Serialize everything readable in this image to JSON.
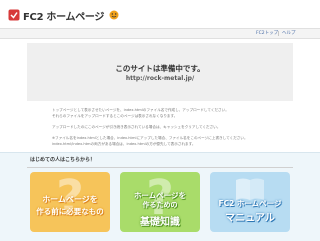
{
  "header": {
    "logo_text": "FC2 ホームページ",
    "logo_icon": "fc2-logo-icon",
    "smile_icon": "smile-icon"
  },
  "nav": {
    "items": [
      {
        "label": "FC2トップ"
      },
      {
        "label": "ヘルプ"
      }
    ]
  },
  "notice": {
    "title": "このサイトは準備中です。",
    "url": "http://rock-metal.jp/"
  },
  "description": {
    "lines": [
      "トップページとして表示させたいページを、index.htmlのファイル名で作成し、アップロードしてください。",
      "それらのファイルをアップロードするとこのページは表示されなくなります。",
      "アップロードしたのにこのページが引き続き表示されている場合は、キャッシュをクリアしてください。",
      "※ファイル名をindex.htmlとした場合、index.htmlにアップした場合、ファイル名をこのページに上書きしてください。",
      "index.html/index.htmの両方がある場合は、index.htmlの方が優先して表示されます。"
    ]
  },
  "section": {
    "title": "はじめての人はこちらから！"
  },
  "cards": [
    {
      "line1": "ホームページを",
      "line2": "作る前に必要なもの",
      "mark": "?"
    },
    {
      "line1": "ホームページを",
      "line2": "作るための",
      "line3": "基礎知識",
      "mark": "?"
    },
    {
      "line1": "FC2 ホームページ",
      "line2": "マニュアル",
      "mark": "?"
    }
  ],
  "colors": {
    "card1": "#f6c45a",
    "card2": "#a9dc6a",
    "card3": "#b7dcf2",
    "link": "#4a6da7",
    "notice_bg": "#efefef"
  }
}
